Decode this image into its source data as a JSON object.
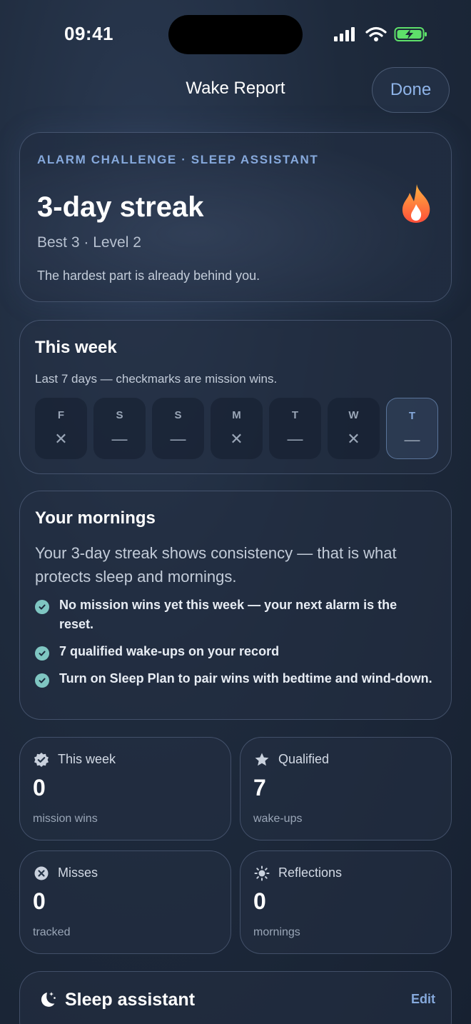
{
  "status": {
    "time": "09:41"
  },
  "nav": {
    "title": "Wake Report",
    "done_label": "Done"
  },
  "hero": {
    "tag": "ALARM CHALLENGE · SLEEP ASSISTANT",
    "title": "3-day streak",
    "subtitle": "Best 3 · Level 2",
    "note": "The hardest part is already behind you."
  },
  "week": {
    "title": "This week",
    "subtitle": "Last 7 days — checkmarks are mission wins.",
    "days": [
      {
        "letter": "F",
        "mark": "✕"
      },
      {
        "letter": "S",
        "mark": "—"
      },
      {
        "letter": "S",
        "mark": "—"
      },
      {
        "letter": "M",
        "mark": "✕"
      },
      {
        "letter": "T",
        "mark": "—"
      },
      {
        "letter": "W",
        "mark": "✕"
      },
      {
        "letter": "T",
        "mark": "—"
      }
    ]
  },
  "mornings": {
    "title": "Your mornings",
    "body": "Your 3-day streak shows consistency — that is what protects sleep and mornings.",
    "bullets": [
      "No mission wins yet this week — your next alarm is the reset.",
      "7 qualified wake-ups on your record",
      "Turn on Sleep Plan to pair wins with bedtime and wind-down."
    ]
  },
  "stats": [
    {
      "label": "This week",
      "value": "0",
      "unit": "mission wins",
      "icon": "verified-badge-icon"
    },
    {
      "label": "Qualified",
      "value": "7",
      "unit": "wake-ups",
      "icon": "star-icon"
    },
    {
      "label": "Misses",
      "value": "0",
      "unit": "tracked",
      "icon": "x-circle-icon"
    },
    {
      "label": "Reflections",
      "value": "0",
      "unit": "mornings",
      "icon": "sun-icon"
    }
  ],
  "assistant": {
    "title": "Sleep assistant",
    "edit_label": "Edit",
    "icon": "moon-stars-icon"
  },
  "colors": {
    "accent": "#86a9dc",
    "check": "#7fc6c2",
    "flame": "#ff6a3d"
  }
}
